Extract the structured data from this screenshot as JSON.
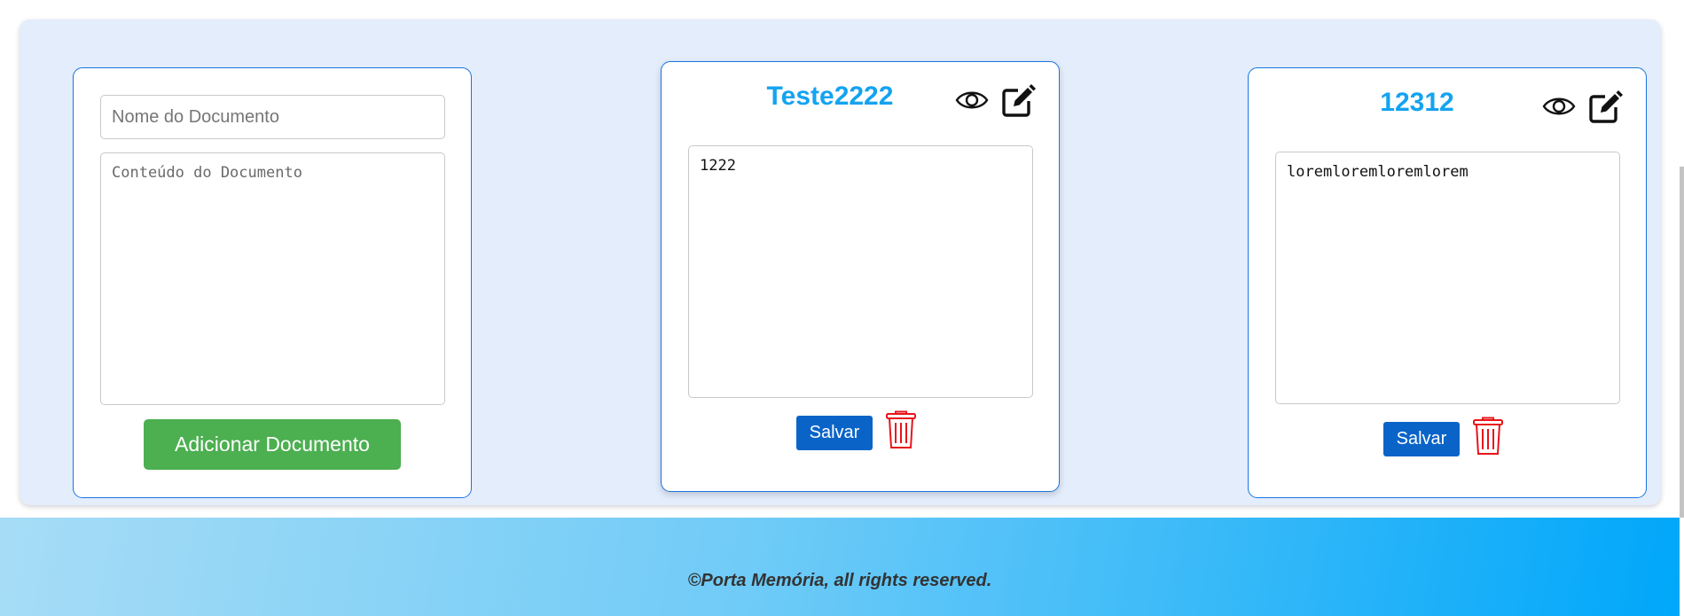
{
  "new_document": {
    "name_placeholder": "Nome do Documento",
    "content_placeholder": "Conteúdo do Documento",
    "add_button_label": "Adicionar Documento"
  },
  "documents": [
    {
      "title": "Teste2222",
      "content": "1222",
      "save_label": "Salvar",
      "icons": [
        "eye-icon",
        "edit-icon",
        "trash-icon"
      ]
    },
    {
      "title": "12312",
      "content": "loremloremloremlorem",
      "save_label": "Salvar",
      "icons": [
        "eye-icon",
        "edit-icon",
        "trash-icon"
      ]
    }
  ],
  "footer": {
    "text": "©Porta Memória, all rights reserved."
  },
  "colors": {
    "panel_bg": "#e3edfc",
    "card_border": "#1a74e0",
    "title": "#14a3f0",
    "add_button": "#4caf50",
    "save_button": "#0a64c8",
    "trash": "#e8141a",
    "footer_start": "#a7dcf6",
    "footer_end": "#00a7fa"
  }
}
